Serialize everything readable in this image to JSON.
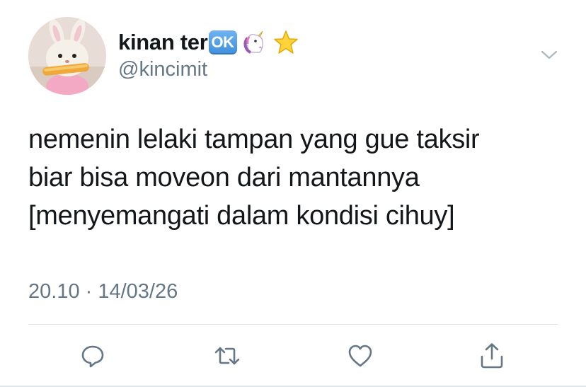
{
  "user": {
    "display_name": "kinan ter",
    "badge_text": "OK",
    "handle": "@kincimit",
    "name_emojis": [
      "unicorn-icon",
      "star-icon"
    ]
  },
  "tweet": {
    "lines": [
      "nemenin lelaki tampan yang gue taksir",
      "biar bisa moveon dari mantannya",
      "[menyemangati dalam kondisi cihuy]"
    ],
    "timestamp": "20.10 · 14/03/26"
  },
  "actions": [
    "reply-icon",
    "retweet-icon",
    "like-icon",
    "share-icon"
  ],
  "colors": {
    "text": "#14171a",
    "secondary_text": "#657786",
    "divider": "#e1e8ed",
    "badge": "#4a97e0"
  }
}
